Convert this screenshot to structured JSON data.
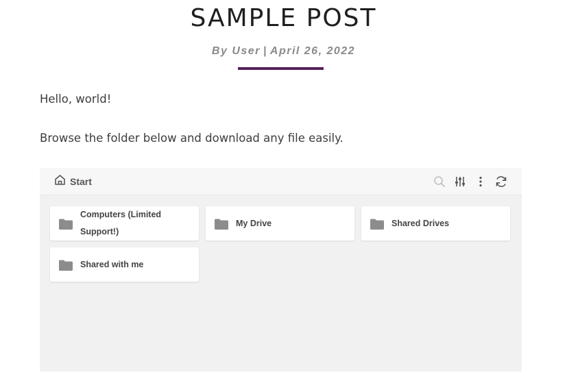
{
  "post": {
    "title": "SAMPLE POST",
    "author": "By User",
    "separator": "|",
    "date": "April 26, 2022",
    "paragraphs": [
      "Hello, world!",
      "Browse the folder below and download any file easily."
    ]
  },
  "browser": {
    "breadcrumb": "Start",
    "toolbar_icons": [
      "search-icon",
      "filter-sliders-icon",
      "more-vertical-icon",
      "refresh-icon"
    ],
    "folders": [
      {
        "label": "Computers (Limited Support!)",
        "icon": "folder-icon"
      },
      {
        "label": "My Drive",
        "icon": "folder-icon"
      },
      {
        "label": "Shared Drives",
        "icon": "folder-icon"
      },
      {
        "label": "Shared with me",
        "icon": "folder-icon"
      }
    ]
  },
  "colors": {
    "accent": "#56215a",
    "folder_icon": "#8c8c8c",
    "panel_bg": "#f1f1f1"
  }
}
